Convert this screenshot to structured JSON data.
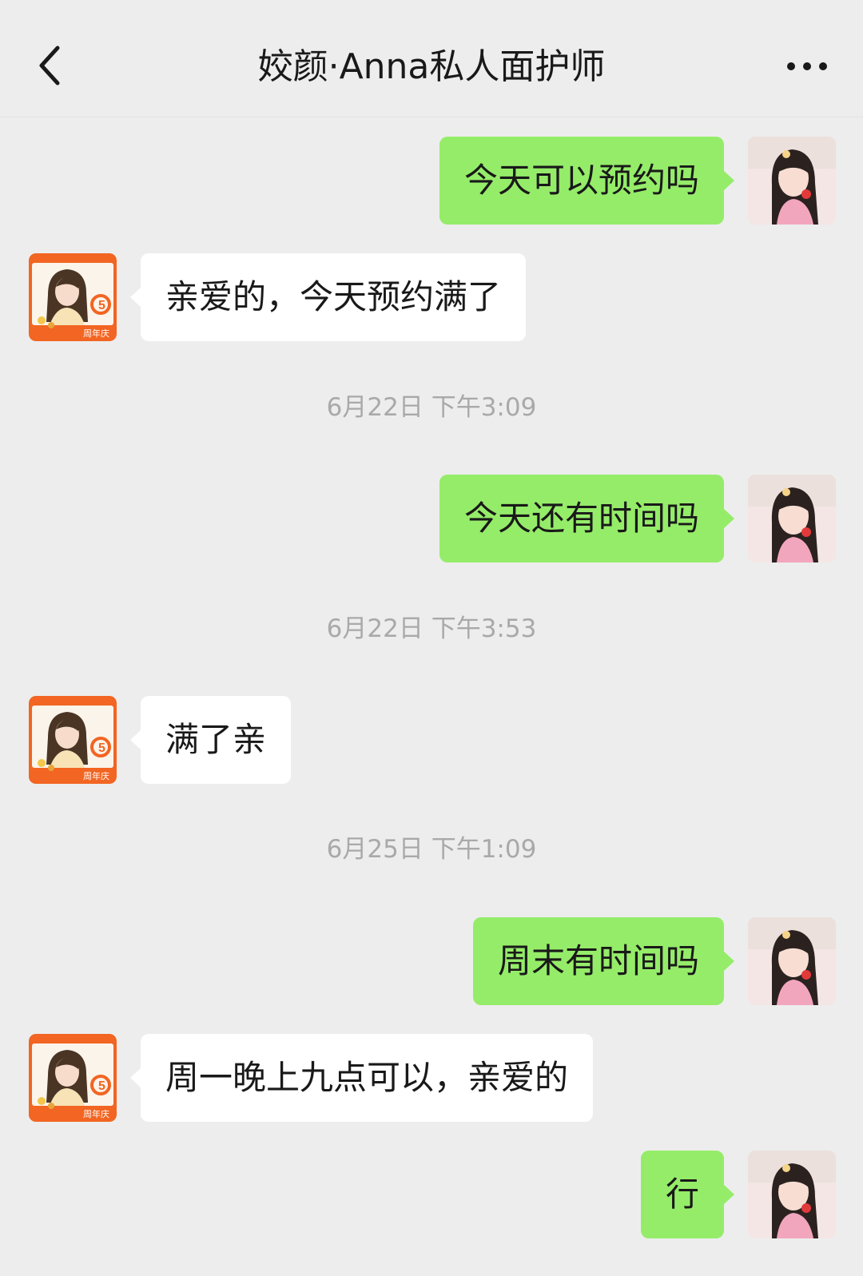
{
  "header": {
    "title": "姣颜·Anna私人面护师",
    "back_icon": "chevron-left-icon",
    "more_icon": "more-dots-icon"
  },
  "colors": {
    "background": "#ededed",
    "outgoing_bubble": "#95ec69",
    "incoming_bubble": "#ffffff",
    "timestamp_text": "#a9a9a9",
    "contact_avatar_accent": "#f26522"
  },
  "contact_avatar": {
    "badge_number": "5",
    "badge_text": "周年庆"
  },
  "messages": [
    {
      "type": "message",
      "direction": "out",
      "text": "今天可以预约吗"
    },
    {
      "type": "message",
      "direction": "in",
      "text": "亲爱的，今天预约满了"
    },
    {
      "type": "timestamp",
      "text": "6月22日 下午3:09"
    },
    {
      "type": "message",
      "direction": "out",
      "text": "今天还有时间吗"
    },
    {
      "type": "timestamp",
      "text": "6月22日 下午3:53"
    },
    {
      "type": "message",
      "direction": "in",
      "text": "满了亲"
    },
    {
      "type": "timestamp",
      "text": "6月25日 下午1:09"
    },
    {
      "type": "message",
      "direction": "out",
      "text": "周末有时间吗"
    },
    {
      "type": "message",
      "direction": "in",
      "text": "周一晚上九点可以，亲爱的"
    },
    {
      "type": "message",
      "direction": "out",
      "text": "行"
    }
  ]
}
